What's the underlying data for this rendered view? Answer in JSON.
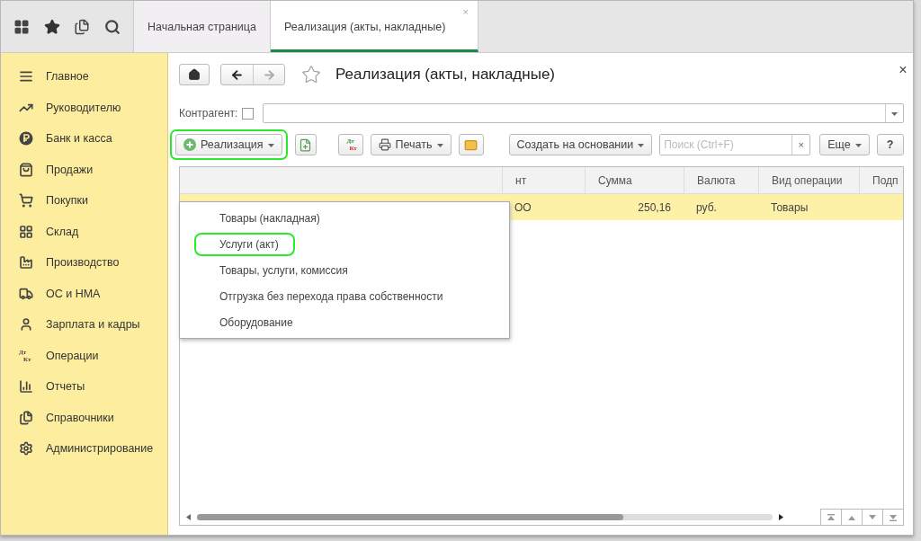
{
  "top_bar": {
    "tabs": [
      {
        "label": "Начальная страница",
        "selected": false
      },
      {
        "label": "Реализация (акты, накладные)",
        "selected": true,
        "close": "×"
      }
    ]
  },
  "sidebar": {
    "items": [
      {
        "label": "Главное"
      },
      {
        "label": "Руководителю"
      },
      {
        "label": "Банк и касса"
      },
      {
        "label": "Продажи"
      },
      {
        "label": "Покупки"
      },
      {
        "label": "Склад"
      },
      {
        "label": "Производство"
      },
      {
        "label": "ОС и НМА"
      },
      {
        "label": "Зарплата и кадры"
      },
      {
        "label": "Операции",
        "icon_text_top": "Дт",
        "icon_text_bottom": "Кт"
      },
      {
        "label": "Отчеты"
      },
      {
        "label": "Справочники"
      },
      {
        "label": "Администрирование"
      }
    ]
  },
  "form": {
    "title": "Реализация (акты, накладные)",
    "close": "×",
    "filter": {
      "label": "Контрагент:",
      "checked": false
    },
    "toolbar": {
      "create_button": {
        "label": "Реализация",
        "highlighted": true
      },
      "dtkt": {
        "top": "Дт",
        "bottom": "Кт"
      },
      "print_button": "Печать",
      "based_on_button": "Создать на основании",
      "search": {
        "placeholder": "Поиск (Ctrl+F)",
        "clear": "×"
      },
      "more_button": "Еще",
      "help_button": "?"
    },
    "dropdown": [
      {
        "label": "Товары (накладная)",
        "highlighted": false
      },
      {
        "label": "Услуги (акт)",
        "highlighted": true
      },
      {
        "label": "Товары, услуги, комиссия",
        "highlighted": false
      },
      {
        "label": "Отгрузка без перехода права собственности",
        "highlighted": false
      },
      {
        "label": "Оборудование",
        "highlighted": false
      }
    ],
    "table": {
      "columns": [
        "нт",
        "Сумма",
        "Валюта",
        "Вид операции",
        "Подп"
      ],
      "rows": [
        {
          "selected": true,
          "cells": [
            "ОО",
            "250,16",
            "руб.",
            "Товары"
          ]
        }
      ]
    }
  }
}
